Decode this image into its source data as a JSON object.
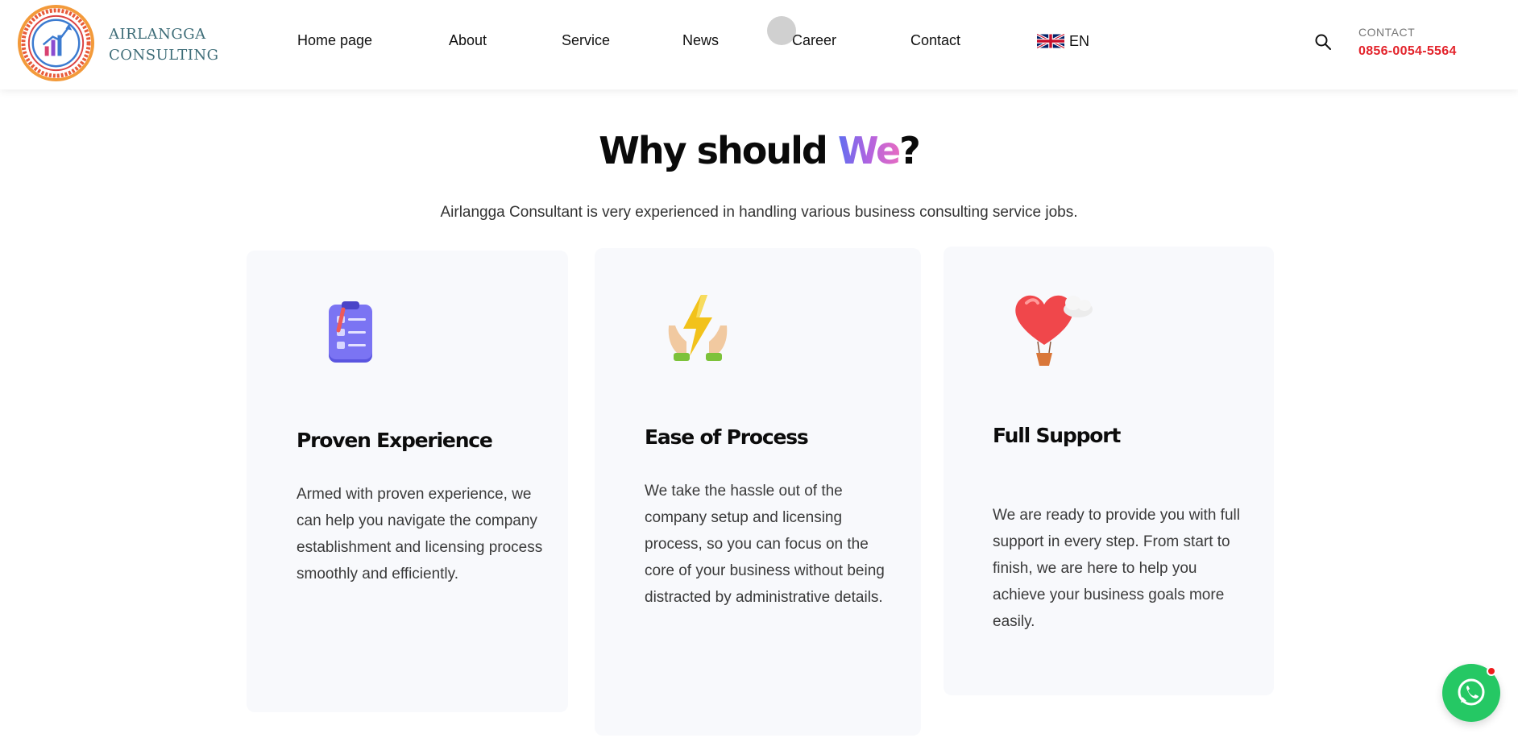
{
  "brand": {
    "line1": "AIRLANGGA",
    "line2": "CONSULTING"
  },
  "nav": {
    "items": [
      {
        "label": "Home page"
      },
      {
        "label": "About"
      },
      {
        "label": "Service"
      },
      {
        "label": "News"
      },
      {
        "label": "Career"
      },
      {
        "label": "Contact"
      }
    ],
    "language": "EN"
  },
  "contact": {
    "label": "CONTACT",
    "phone": "0856-0054-5564"
  },
  "section": {
    "heading_part1": "Why should ",
    "heading_accent": "We",
    "heading_part2": "?",
    "subtitle": "Airlangga Consultant is very experienced in handling various business consulting service jobs."
  },
  "cards": [
    {
      "title": "Proven Experience",
      "text": "Armed with proven experience, we can help you navigate the company establishment and licensing process smoothly and efficiently.",
      "icon": "clipboard-icon"
    },
    {
      "title": "Ease of Process",
      "text": "We take the hassle out of the company setup and licensing process, so you can focus on the core of your business without being distracted by administrative details.",
      "icon": "lightning-hands-icon"
    },
    {
      "title": "Full Support",
      "text": "We are ready to provide you with full support in every step. From start to finish, we are here to help you achieve your business goals more easily.",
      "icon": "heart-balloon-icon"
    }
  ],
  "colors": {
    "brand_teal": "#3e6d78",
    "phone_red": "#e3232b",
    "whatsapp_green": "#25c864",
    "card_bg": "#f8f9fc"
  }
}
